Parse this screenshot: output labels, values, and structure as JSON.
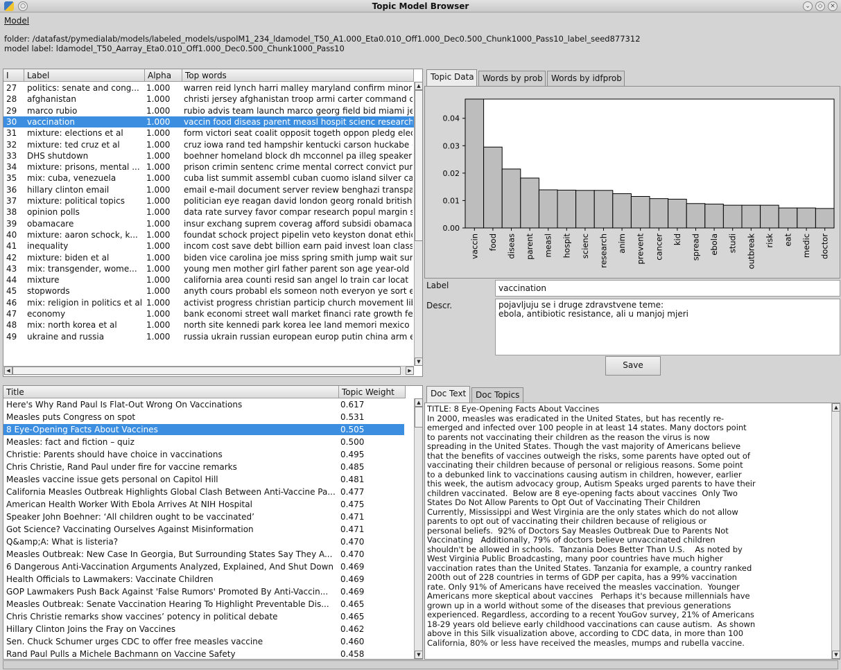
{
  "window": {
    "title": "Topic Model Browser"
  },
  "menu": {
    "model_label": "Model"
  },
  "info": {
    "folder": "folder: /datafast/pymedialab/models/labeled_models/uspolM1_234_ldamodel_T50_A1.000_Eta0.010_Off1.000_Dec0.500_Chunk1000_Pass10_label_seed877312",
    "model_label": "model label: ldamodel_T50_Aarray_Eta0.010_Off1.000_Dec0.500_Chunk1000_Pass10"
  },
  "topics_table": {
    "headers": [
      "I",
      "Label",
      "Alpha",
      "Top words"
    ],
    "selected_index": 3,
    "rows": [
      {
        "id": "27",
        "label": "politics: senate and cong...",
        "alpha": "1.000",
        "words": "warren reid lynch harri malley maryland confirm minor h"
      },
      {
        "id": "28",
        "label": "afghanistan",
        "alpha": "1.000",
        "words": "christi jersey afghanistan troop armi carter command c"
      },
      {
        "id": "29",
        "label": "marco rubio",
        "alpha": "1.000",
        "words": "rubio advis team launch marco georg field bid miami jeb"
      },
      {
        "id": "30",
        "label": "vaccination",
        "alpha": "1.000",
        "words": "vaccin food diseas parent measl hospit scienc research"
      },
      {
        "id": "31",
        "label": "mixture: elections et al",
        "alpha": "1.000",
        "words": "form victori seat coalit opposit togeth oppon pledg elect"
      },
      {
        "id": "32",
        "label": "mixture: ted cruz et al",
        "alpha": "1.000",
        "words": "cruz iowa rand ted hampshir kentucki carson huckabe c"
      },
      {
        "id": "33",
        "label": "DHS shutdown",
        "alpha": "1.000",
        "words": "boehner homeland block dh mcconnel pa illeg speaker"
      },
      {
        "id": "34",
        "label": "mixture: prisons, mental ...",
        "alpha": "1.000",
        "words": "prison crimin sentenc crime mental correct convict pun"
      },
      {
        "id": "35",
        "label": "mix: cuba, venezuela",
        "alpha": "1.000",
        "words": "cuba list summit assembl cuban cuomo island silver ca"
      },
      {
        "id": "36",
        "label": "hillary clinton email",
        "alpha": "1.000",
        "words": "email e-mail document server review benghazi transpa"
      },
      {
        "id": "37",
        "label": "mixture: political topics",
        "alpha": "1.000",
        "words": "politician eye reagan david london georg ronald british l"
      },
      {
        "id": "38",
        "label": "opinion polls",
        "alpha": "1.000",
        "words": "data rate survey favor compar research popul margin s"
      },
      {
        "id": "39",
        "label": "obamacare",
        "alpha": "1.000",
        "words": "insur exchang suprem coverag afford subsidi obamacar"
      },
      {
        "id": "40",
        "label": "mixture: aaron schock, k...",
        "alpha": "1.000",
        "words": "foundat schock project pipelin veto keyston donat ethic"
      },
      {
        "id": "41",
        "label": "inequality",
        "alpha": "1.000",
        "words": "incom cost save debt billion earn paid invest loan class"
      },
      {
        "id": "42",
        "label": "mixture: biden et al",
        "alpha": "1.000",
        "words": "biden vice carolina joe miss spring smith jump wait sum"
      },
      {
        "id": "43",
        "label": "mix: transgender, wome...",
        "alpha": "1.000",
        "words": "young men mother girl father parent son age year-old b"
      },
      {
        "id": "44",
        "label": "mixture",
        "alpha": "1.000",
        "words": "california area counti resid san angel lo train car locat"
      },
      {
        "id": "45",
        "label": "stopwords",
        "alpha": "1.000",
        "words": "anyth cours probabl els someon noth everyon ye sort e"
      },
      {
        "id": "46",
        "label": "mix: religion in politics et al",
        "alpha": "1.000",
        "words": "activist progress christian particip church movement lib"
      },
      {
        "id": "47",
        "label": "economy",
        "alpha": "1.000",
        "words": "bank economi street wall market financi rate growth fed"
      },
      {
        "id": "48",
        "label": "mix: north korea et al",
        "alpha": "1.000",
        "words": "north site kennedi park korea lee land memori mexico b"
      },
      {
        "id": "49",
        "label": "ukraine and russia",
        "alpha": "1.000",
        "words": "russia ukrain russian european europ putin china arm e"
      }
    ]
  },
  "topic_tabs": [
    "Topic Data",
    "Words by prob",
    "Words by idfprob"
  ],
  "chart_data": {
    "type": "bar",
    "categories": [
      "vaccin",
      "food",
      "diseas",
      "parent",
      "measl",
      "hospit",
      "scienc",
      "research",
      "anim",
      "prevent",
      "cancer",
      "kid",
      "spread",
      "ebola",
      "studi",
      "outbreak",
      "risk",
      "eat",
      "medic",
      "doctor"
    ],
    "values": [
      0.048,
      0.0295,
      0.0215,
      0.0182,
      0.0139,
      0.0138,
      0.0137,
      0.0137,
      0.0125,
      0.0115,
      0.0107,
      0.0105,
      0.0089,
      0.0087,
      0.0083,
      0.0083,
      0.0083,
      0.0073,
      0.0073,
      0.0071
    ],
    "yticks": [
      "0.00",
      "0.01",
      "0.02",
      "0.03",
      "0.04"
    ],
    "ylim": [
      0,
      0.047
    ],
    "bar_color": "#bdbdbd"
  },
  "topic_form": {
    "label_caption": "Label",
    "label_value": "vaccination",
    "descr_caption": "Descr.",
    "descr_value": "pojavljuju se i druge zdravstvene teme:\nebola, antibiotic resistance, ali u manjoj mjeri",
    "save_label": "Save"
  },
  "docs_table": {
    "headers": [
      "Title",
      "Topic Weight"
    ],
    "selected_index": 2,
    "rows": [
      {
        "title": "Here's Why Rand Paul Is Flat-Out Wrong On Vaccinations",
        "weight": "0.617"
      },
      {
        "title": "Measles puts Congress on spot",
        "weight": "0.531"
      },
      {
        "title": "8 Eye-Opening Facts About Vaccines",
        "weight": "0.505"
      },
      {
        "title": "Measles: fact and fiction – quiz",
        "weight": "0.500"
      },
      {
        "title": "Christie: Parents should have choice in vaccinations",
        "weight": "0.495"
      },
      {
        "title": "Chris Christie, Rand Paul under fire for vaccine remarks",
        "weight": "0.485"
      },
      {
        "title": "Measles vaccine issue gets personal on Capitol Hill",
        "weight": "0.481"
      },
      {
        "title": "California Measles Outbreak Highlights Global Clash Between Anti-Vaccine Pa...",
        "weight": "0.477"
      },
      {
        "title": "American Health Worker With Ebola Arrives At NIH Hospital",
        "weight": "0.475"
      },
      {
        "title": "Speaker John Boehner: ‘All children ought to be vaccinated’",
        "weight": "0.471"
      },
      {
        "title": "Got Science? Vaccinating Ourselves Against Misinformation",
        "weight": "0.471"
      },
      {
        "title": "Q&amp;A: What is listeria?",
        "weight": "0.470"
      },
      {
        "title": "Measles Outbreak: New Case In Georgia, But Surrounding States Say They A...",
        "weight": "0.470"
      },
      {
        "title": "6 Dangerous Anti-Vaccination Arguments Analyzed, Explained, And Shut Down",
        "weight": "0.469"
      },
      {
        "title": "Health Officials to Lawmakers: Vaccinate Children",
        "weight": "0.469"
      },
      {
        "title": "GOP Lawmakers Push Back Against 'False Rumors' Promoted By Anti-Vaccin...",
        "weight": "0.469"
      },
      {
        "title": "Measles Outbreak: Senate Vaccination Hearing To Highlight Preventable Dis...",
        "weight": "0.465"
      },
      {
        "title": "Chris Christie remarks show vaccines’ potency in political debate",
        "weight": "0.465"
      },
      {
        "title": "Hillary Clinton Joins the Fray on Vaccines",
        "weight": "0.462"
      },
      {
        "title": "Sen. Chuck Schumer urges CDC to offer free measles vaccine",
        "weight": "0.460"
      },
      {
        "title": "Rand Paul Pulls a Michele Bachmann on Vaccine Safety",
        "weight": "0.458"
      }
    ]
  },
  "doc_tabs": [
    "Doc Text",
    "Doc Topics"
  ],
  "doc_text": "TITLE: 8 Eye-Opening Facts About Vaccines\nIn 2000, measles was eradicated in the United States, but has recently re-\nemerged and infected over 100 people in at least 14 states. Many doctors point\nto parents not vaccinating their children as the reason the virus is now\nspreading in the United States. Though the vast majority of Americans believe\nthat the benefits of vaccines outweigh the risks, some parents have opted out of\nvaccinating their children because of personal or religious reasons. Some point\nto a debunked link to vaccinations causing autism in children, however, earlier\nthis week, the autism advocacy group, Autism Speaks urged parents to have their\nchildren vaccinated.  Below are 8 eye-opening facts about vaccines  Only Two\nStates Do Not Allow Parents to Opt Out of Vaccinating Their Children\nCurrently, Mississippi and West Virginia are the only states which do not allow\nparents to opt out of vaccinating their children because of religious or\npersonal beliefs.  92% of Doctors Say Measles Outbreak Due to Parents Not\nVaccinating   Additionally, 79% of doctors believe unvaccinated children\nshouldn't be allowed in schools.  Tanzania Does Better Than U.S.    As noted by\nWest Virginia Public Broadcasting, many poor countries have much higher\nvaccination rates than the United States. Tanzania for example, a country ranked\n200th out of 228 countries in terms of GDP per capita, has a 99% vaccination\nrate. Only 91% of Americans have received the measles vaccination.  Younger\nAmericans more skeptical about vaccines   Perhaps it's because millennials have\ngrown up in a world without some of the diseases that previous generations\nexperienced. Regardless, according to a recent YouGov survey, 21% of Americans\n18-29 years old believe early childhood vaccinations can cause autism.  As shown\nabove in this Silk visualization above, according to CDC data, in more than 100\nCalifornia, 80% or less have received the measles, mumps and rubella vaccine."
}
